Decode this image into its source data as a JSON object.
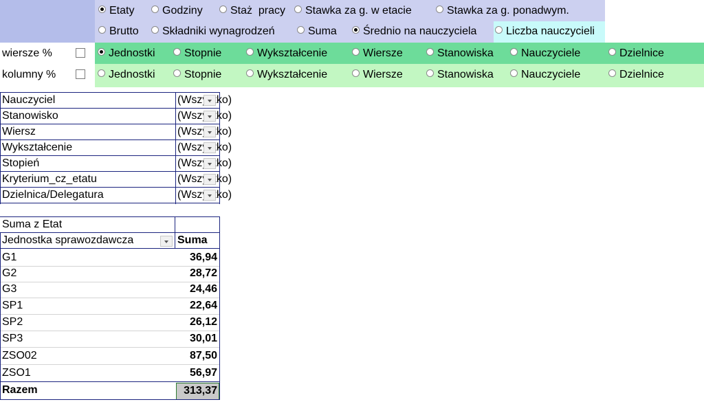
{
  "controls": {
    "row1": [
      {
        "label": "Etaty",
        "selected": true
      },
      {
        "label": "Godziny",
        "selected": false
      },
      {
        "label": "Staż  pracy",
        "selected": false
      },
      {
        "label": "Stawka za g. w etacie",
        "selected": false
      },
      {
        "label": "Stawka za g. ponadwym.",
        "selected": false
      }
    ],
    "row2": [
      {
        "label": "Brutto",
        "selected": false
      },
      {
        "label": "Składniki wynagrodzeń",
        "selected": false
      },
      {
        "label": "Suma",
        "selected": false
      },
      {
        "label": "Średnio na nauczyciela",
        "selected": true
      },
      {
        "label": "Liczba nauczycieli",
        "selected": false
      }
    ],
    "rows_pct": {
      "label": "wiersze %",
      "checked": false,
      "options": [
        {
          "label": "Jednostki",
          "selected": true
        },
        {
          "label": "Stopnie",
          "selected": false
        },
        {
          "label": "Wykształcenie",
          "selected": false
        },
        {
          "label": "Wiersze",
          "selected": false
        },
        {
          "label": "Stanowiska",
          "selected": false
        },
        {
          "label": "Nauczyciele",
          "selected": false
        },
        {
          "label": "Dzielnice",
          "selected": false
        }
      ]
    },
    "cols_pct": {
      "label": "kolumny %",
      "checked": false,
      "options": [
        {
          "label": "Jednostki",
          "selected": false
        },
        {
          "label": "Stopnie",
          "selected": false
        },
        {
          "label": "Wykształcenie",
          "selected": false
        },
        {
          "label": "Wiersze",
          "selected": false
        },
        {
          "label": "Stanowiska",
          "selected": false
        },
        {
          "label": "Nauczyciele",
          "selected": false
        },
        {
          "label": "Dzielnice",
          "selected": false
        }
      ]
    }
  },
  "filters": [
    {
      "name": "Nauczyciel",
      "value": "(Wszystko)"
    },
    {
      "name": "Stanowisko",
      "value": "(Wszystko)"
    },
    {
      "name": "Wiersz",
      "value": "(Wszystko)"
    },
    {
      "name": "Wykształcenie",
      "value": "(Wszystko)"
    },
    {
      "name": "Stopień",
      "value": "(Wszystko)"
    },
    {
      "name": "Kryterium_cz_etatu",
      "value": "(Wszystko)"
    },
    {
      "name": "Dzielnica/Delegatura",
      "value": "(Wszystko)"
    }
  ],
  "pivot": {
    "measure_label": "Suma z Etat",
    "row_field": "Jednostka sprawozdawcza",
    "col_header": "Suma",
    "rows": [
      {
        "name": "G1",
        "value": "36,94"
      },
      {
        "name": "G2",
        "value": "28,72"
      },
      {
        "name": "G3",
        "value": "24,46"
      },
      {
        "name": "SP1",
        "value": "22,64"
      },
      {
        "name": "SP2",
        "value": "26,12"
      },
      {
        "name": "SP3",
        "value": "30,01"
      },
      {
        "name": "ZSO02",
        "value": "87,50"
      },
      {
        "name": "ZSO1",
        "value": "56,97"
      }
    ],
    "total_label": "Razem",
    "total_value": "313,37"
  },
  "colors": {
    "lavender": "#ccd0f0",
    "blue_label": "#b4bdea",
    "green_dark": "#6ddc9a",
    "green_light": "#c2f7c2",
    "cyan": "#c8fafa",
    "border": "#1a237e"
  }
}
